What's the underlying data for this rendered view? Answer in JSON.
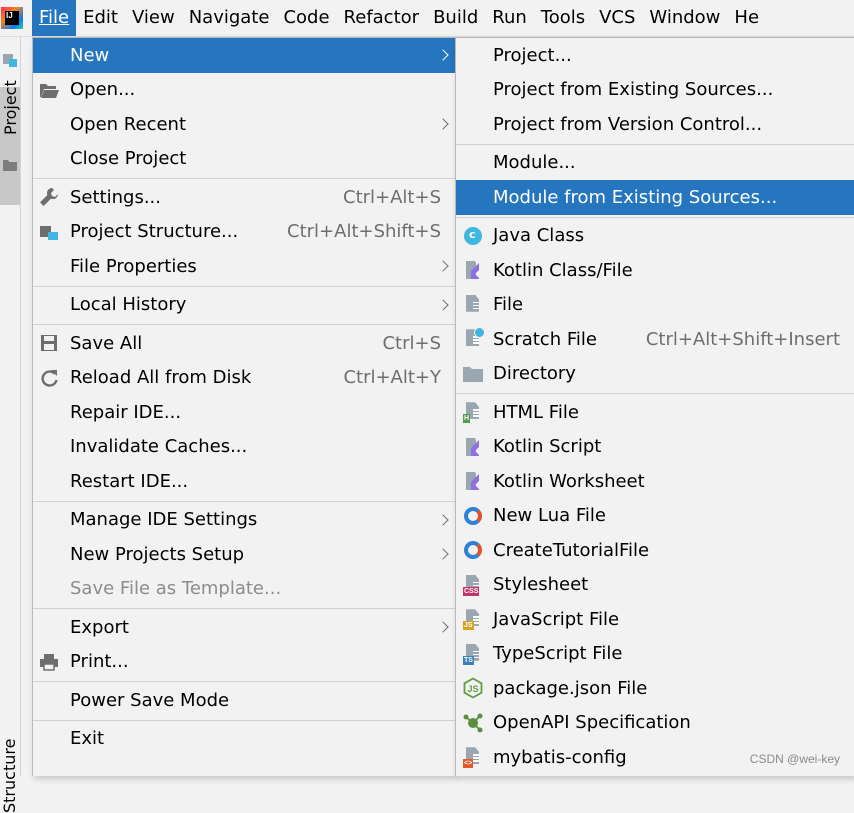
{
  "menubar": {
    "items": [
      "File",
      "Edit",
      "View",
      "Navigate",
      "Code",
      "Refactor",
      "Build",
      "Run",
      "Tools",
      "VCS",
      "Window",
      "He"
    ]
  },
  "sidebar": {
    "project_label": "Project",
    "structure_label": "Structure"
  },
  "file_menu": {
    "new": "New",
    "open": "Open...",
    "open_recent": "Open Recent",
    "close_project": "Close Project",
    "settings": "Settings...",
    "settings_shortcut": "Ctrl+Alt+S",
    "project_structure": "Project Structure...",
    "project_structure_shortcut": "Ctrl+Alt+Shift+S",
    "file_properties": "File Properties",
    "local_history": "Local History",
    "save_all": "Save All",
    "save_all_shortcut": "Ctrl+S",
    "reload_all": "Reload All from Disk",
    "reload_all_shortcut": "Ctrl+Alt+Y",
    "repair_ide": "Repair IDE...",
    "invalidate_caches": "Invalidate Caches...",
    "restart_ide": "Restart IDE...",
    "manage_ide_settings": "Manage IDE Settings",
    "new_projects_setup": "New Projects Setup",
    "save_as_template": "Save File as Template...",
    "export": "Export",
    "print": "Print...",
    "power_save_mode": "Power Save Mode",
    "exit": "Exit"
  },
  "new_submenu": {
    "project": "Project...",
    "project_existing": "Project from Existing Sources...",
    "project_vcs": "Project from Version Control...",
    "module": "Module...",
    "module_existing": "Module from Existing Sources...",
    "java_class": "Java Class",
    "kotlin_class": "Kotlin Class/File",
    "file": "File",
    "scratch_file": "Scratch File",
    "scratch_shortcut": "Ctrl+Alt+Shift+Insert",
    "directory": "Directory",
    "html_file": "HTML File",
    "kotlin_script": "Kotlin Script",
    "kotlin_worksheet": "Kotlin Worksheet",
    "new_lua_file": "New Lua File",
    "create_tutorial": "CreateTutorialFile",
    "stylesheet": "Stylesheet",
    "javascript_file": "JavaScript File",
    "typescript_file": "TypeScript File",
    "package_json": "package.json File",
    "openapi": "OpenAPI Specification",
    "mybatis": "mybatis-config"
  },
  "icons": {
    "java_class_icon": "c-circle",
    "kotlin_icon": "kotlin-logo",
    "file_icon": "text-file",
    "scratch_icon": "scratch-file",
    "directory_icon": "folder",
    "html_icon": "html-file",
    "lua_icon": "lua-ring",
    "css_icon": "css-file",
    "js_icon": "js-file",
    "ts_icon": "ts-file",
    "json_icon": "node-hexagon",
    "openapi_icon": "openapi-graph",
    "mybatis_icon": "xml-file"
  },
  "badges": {
    "html": "H",
    "css": "CSS",
    "js": "JS",
    "ts": "TS",
    "xml": "<>"
  },
  "colors": {
    "selection": "#2675bf",
    "menu_bg": "#f2f2f2",
    "shortcut": "#6e6e6e",
    "disabled": "#8c8c8c",
    "java_class": "#40b6e0",
    "kotlin": "#9aa7b0",
    "html_badge": "#4f9e4f",
    "css_badge": "#c2336a",
    "js_badge": "#d9a21b",
    "ts_badge": "#3d7fb8",
    "xml_badge": "#e05a2b"
  },
  "watermark": "CSDN @wei-key"
}
